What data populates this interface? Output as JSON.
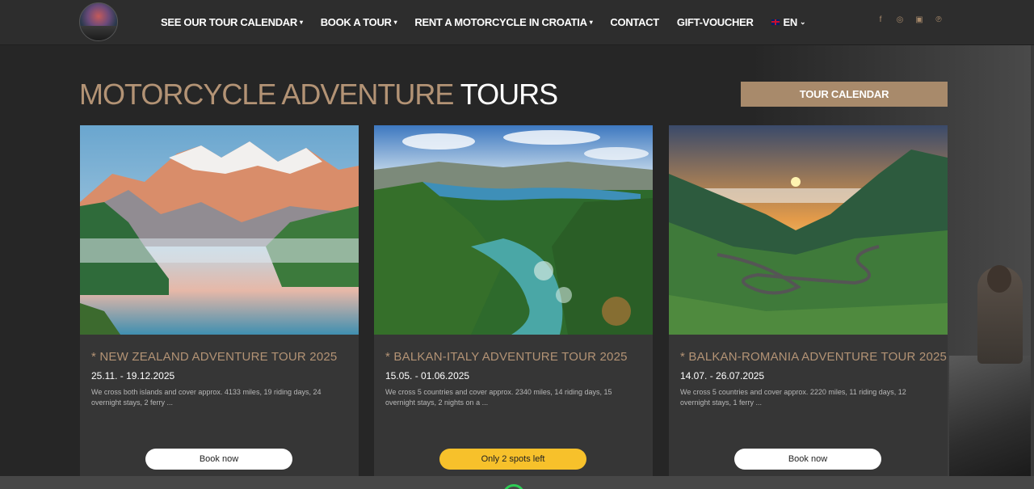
{
  "nav": {
    "items": [
      {
        "label": "SEE OUR TOUR CALENDAR",
        "dropdown": true
      },
      {
        "label": "BOOK A TOUR",
        "dropdown": true
      },
      {
        "label": "RENT A MOTORCYCLE IN CROATIA",
        "dropdown": true
      },
      {
        "label": "CONTACT",
        "dropdown": false
      },
      {
        "label": "GIFT-VOUCHER",
        "dropdown": false
      }
    ],
    "language": "EN",
    "social": [
      "facebook-icon",
      "instagram-icon",
      "youtube-icon",
      "pinterest-icon"
    ]
  },
  "heading": {
    "part1": "MOTORCYCLE ADVENTURE",
    "part2": "TOURS"
  },
  "tour_calendar_button": "TOUR CALENDAR",
  "cards": [
    {
      "title": "* NEW ZEALAND ADVENTURE TOUR 2025",
      "dates": "25.11. - 19.12.2025",
      "description": "We cross both islands and cover approx. 4133 miles, 19 riding days, 24 overnight stays, 2 ferry ...",
      "button": "Book now"
    },
    {
      "title": "* BALKAN-ITALY ADVENTURE TOUR 2025",
      "dates": "15.05. - 01.06.2025",
      "description": "We cross 5 countries and cover approx. 2340 miles, 14 riding days, 15 overnight stays, 2 nights on a ...",
      "button": "Only 2 spots left"
    },
    {
      "title": "* BALKAN-ROMANIA ADVENTURE TOUR 2025",
      "dates": "14.07. - 26.07.2025",
      "description": "We cross 5 countries and cover approx. 2220 miles, 11 riding days, 12 overnight stays, 1 ferry ...",
      "button": "Book now"
    }
  ],
  "colors": {
    "accent_gold": "#b39375",
    "button_gold": "#a88a6b",
    "highlight_yellow": "#f7c12b",
    "background": "#262626"
  }
}
